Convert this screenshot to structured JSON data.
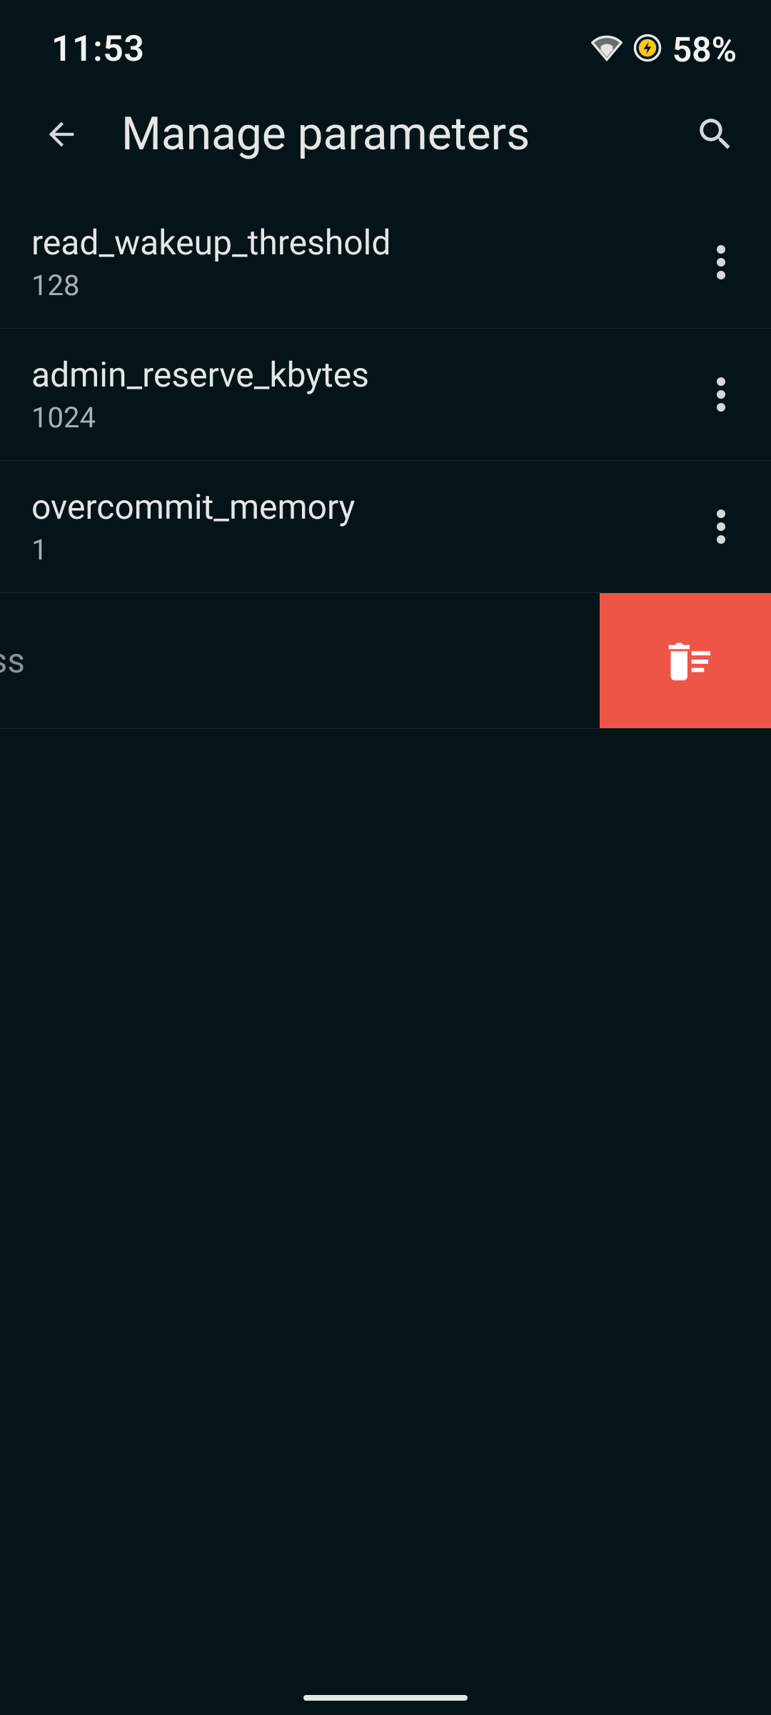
{
  "status": {
    "time": "11:53",
    "battery": "58%"
  },
  "appbar": {
    "title": "Manage parameters"
  },
  "params": [
    {
      "name": "read_wakeup_threshold",
      "value": "128"
    },
    {
      "name": "admin_reserve_kbytes",
      "value": "1024"
    },
    {
      "name": "overcommit_memory",
      "value": "1"
    }
  ],
  "swiped": {
    "fragment": "ess"
  }
}
